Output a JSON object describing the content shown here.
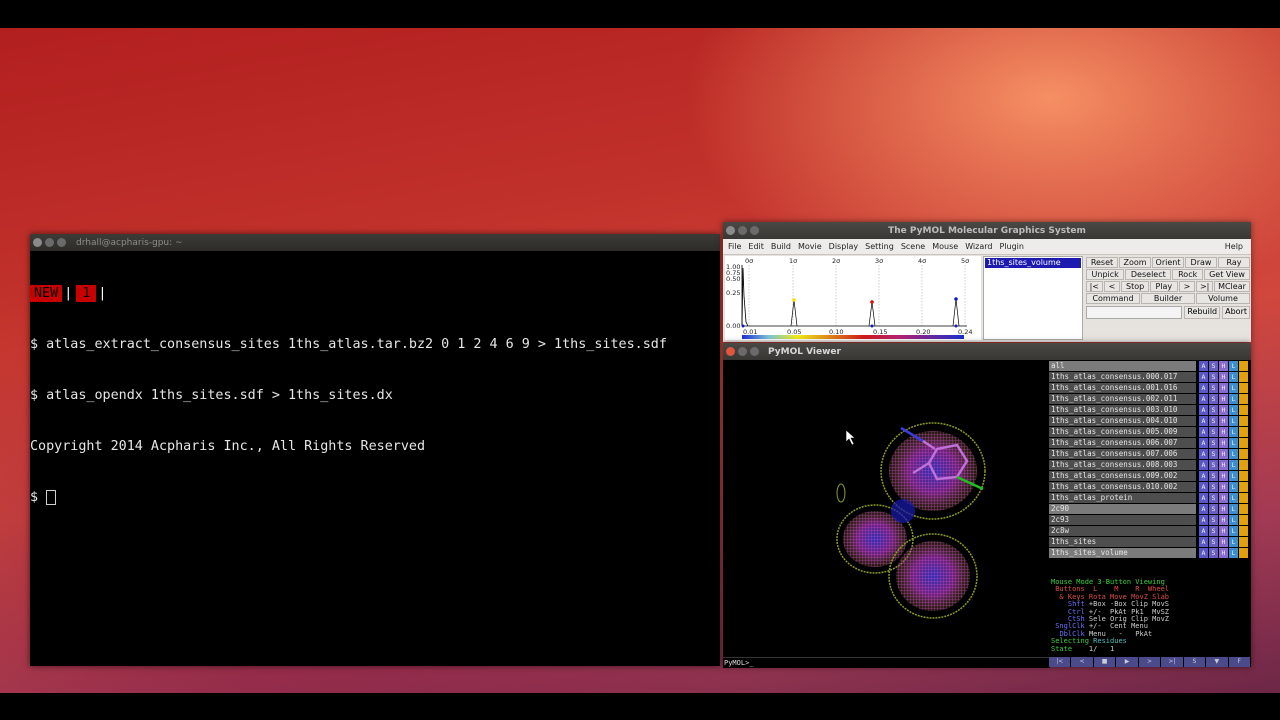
{
  "terminal": {
    "title": "drhall@acpharis-gpu: ~",
    "tabs": [
      "NEW",
      "1"
    ],
    "lines": [
      "$ atlas_extract_consensus_sites 1ths_atlas.tar.bz2 0 1 2 4 6 9 > 1ths_sites.sdf",
      "$ atlas_opendx 1ths_sites.sdf > 1ths_sites.dx",
      "Copyright 2014 Acpharis Inc., All Rights Reserved",
      "$ "
    ]
  },
  "pymol_gui": {
    "title": "The PyMOL Molecular Graphics System",
    "menu": [
      "File",
      "Edit",
      "Build",
      "Movie",
      "Display",
      "Setting",
      "Scene",
      "Mouse",
      "Wizard",
      "Plugin"
    ],
    "help": "Help",
    "plot": {
      "sigma_labels": [
        "0σ",
        "1σ",
        "2σ",
        "3σ",
        "4σ",
        "5σ"
      ],
      "y_labels": [
        "1.00",
        "0.75",
        "0.50",
        "0.25",
        "0.00"
      ],
      "x_labels": [
        "0.01",
        "0.05",
        "0.10",
        "0.15",
        "0.20",
        "0.24"
      ],
      "peak_colors": [
        "#f2e400",
        "#d01010",
        "#1020c0"
      ]
    },
    "object_list": [
      "1ths_sites_volume"
    ],
    "buttons": [
      "Reset",
      "Zoom",
      "Orient",
      "Draw",
      "Ray",
      "Unpick",
      "Deselect",
      "Rock",
      "Get View",
      "|<",
      "<",
      "Stop",
      "Play",
      ">",
      ">|",
      "MClear"
    ],
    "row_buttons": [
      "Command",
      "Builder",
      "Volume"
    ],
    "rebuild": "Rebuild",
    "abort": "Abort"
  },
  "pymol_viewer": {
    "title": "PyMOL Viewer",
    "prompt": "PyMOL>_",
    "objects": [
      {
        "name": "all",
        "style": "grey"
      },
      {
        "name": "1ths_atlas_consensus.000.017",
        "style": "enabled"
      },
      {
        "name": "1ths_atlas_consensus.001.016",
        "style": "enabled"
      },
      {
        "name": "1ths_atlas_consensus.002.011",
        "style": "enabled"
      },
      {
        "name": "1ths_atlas_consensus.003.010",
        "style": "enabled"
      },
      {
        "name": "1ths_atlas_consensus.004.010",
        "style": "enabled"
      },
      {
        "name": "1ths_atlas_consensus.005.009",
        "style": "enabled"
      },
      {
        "name": "1ths_atlas_consensus.006.007",
        "style": "enabled"
      },
      {
        "name": "1ths_atlas_consensus.007.006",
        "style": "enabled"
      },
      {
        "name": "1ths_atlas_consensus.008.003",
        "style": "enabled"
      },
      {
        "name": "1ths_atlas_consensus.009.002",
        "style": "enabled"
      },
      {
        "name": "1ths_atlas_consensus.010.002",
        "style": "enabled"
      },
      {
        "name": "1ths_atlas_protein",
        "style": "enabled"
      },
      {
        "name": "2c90",
        "style": "grey"
      },
      {
        "name": "2c93",
        "style": "enabled"
      },
      {
        "name": "2c8w",
        "style": "enabled"
      },
      {
        "name": "1ths_sites",
        "style": "enabled"
      },
      {
        "name": "1ths_sites_volume",
        "style": "grey"
      }
    ],
    "object_tags": [
      "A",
      "S",
      "H",
      "L",
      ""
    ],
    "mouse_help": {
      "mode": "Mouse Mode 3-Button Viewing",
      "buttons_line": " Buttons  L    M    R  Wheel",
      "keys_line": "  & Keys Rota Move MovZ Slab",
      "shft_label": "Shft",
      "shft_line": " +Box -Box Clip MovS",
      "ctrl_label": "Ctrl",
      "ctrl_line": " +/-  PkAt Pk1  MvSZ",
      "ctsh_label": "CtSh",
      "ctsh_line": " Sele Orig Clip MovZ",
      "sngl_label": "SnglClk",
      "sngl_line": " +/-  Cent Menu",
      "dbl_label": "DblClk",
      "dbl_line": " Menu   -   PkAt",
      "selecting_label": "Selecting ",
      "selecting_value": "Residues",
      "state_label": "State",
      "state_value": "    1/   1"
    },
    "movie_controls": [
      "|<",
      "<",
      "■",
      "▶",
      ">",
      ">|",
      "S",
      "▼",
      "F"
    ]
  }
}
